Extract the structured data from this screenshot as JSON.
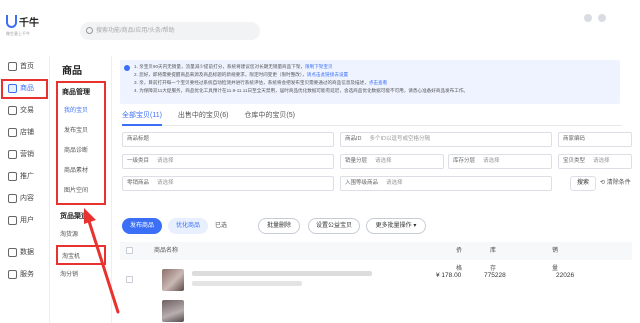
{
  "app": {
    "logo_text": "千牛",
    "logo_sub": "做生意上千牛",
    "search_placeholder": "搜索功能/商品/应用/头条/帮助"
  },
  "sidebar": {
    "items": [
      {
        "label": "首页",
        "icon": "home-icon"
      },
      {
        "label": "商品",
        "icon": "product-icon",
        "active": true
      },
      {
        "label": "交易",
        "icon": "trade-icon"
      },
      {
        "label": "店铺",
        "icon": "store-icon"
      },
      {
        "label": "营销",
        "icon": "marketing-icon"
      },
      {
        "label": "推广",
        "icon": "promotion-icon"
      },
      {
        "label": "内容",
        "icon": "content-icon"
      },
      {
        "label": "用户",
        "icon": "user-icon"
      },
      {
        "label": "数据",
        "icon": "data-icon"
      },
      {
        "label": "服务",
        "icon": "service-icon"
      }
    ]
  },
  "submenu": {
    "title": "商品",
    "group1": {
      "head": "商品管理",
      "items": [
        "我的宝贝",
        "发布宝贝",
        "商品诊断",
        "商品素材",
        "图片空间"
      ]
    },
    "group2": {
      "head": "货品渠道",
      "items": [
        "淘货源",
        "淘宝机",
        "淘分销"
      ]
    }
  },
  "notice": {
    "lines": [
      {
        "text": "1. 亲宝贝90天内无销量，流量减少提前打分，系统将建议您对长期无销量商品下架，",
        "link": "限制下架宝贝"
      },
      {
        "text": "2. 您好，即将需要提醒商品来源及商品标题的新规要求，限定时间变更（限时整改），",
        "link": "请点击此链接去设置"
      },
      {
        "text": "3. 亲，目前打开每一个宝贝要经过系统自动检测并进行系统评估，系统将会把发布宝贝需要通过的商品信息及描述，",
        "link": "点击查看"
      },
      {
        "text": "4. 为保障双11大促服务，商品优化工具预计在11.9-11.11日至全天禁用，届时商品优化数据可能有延迟，含选商品优化数据可能不可用，请悉心准备好商品发布工作。",
        "link": ""
      }
    ]
  },
  "tabs": [
    "全部宝贝(11)",
    "出售中的宝贝(6)",
    "仓库中的宝贝(5)"
  ],
  "filters": {
    "title_label": "商品标题",
    "id_label": "商品ID",
    "id_placeholder": "多个ID以逗号或空格分隔",
    "code_label": "商家编码",
    "category_label": "一级类目",
    "select_placeholder": "请选择",
    "sales_label": "销量分层",
    "stock_label": "库存分层",
    "type_label": "宝贝类型",
    "unlist_label": "零销商品",
    "source_label": "入围等级商品",
    "search_btn": "搜索",
    "clear_link": "清除条件"
  },
  "actions": {
    "publish": "发布商品",
    "optimize": "优化商品",
    "selected": "已选",
    "batch_delete": "批量删除",
    "set_public": "设置公益宝贝",
    "more": "更多批量操作"
  },
  "table": {
    "headers": {
      "name": "商品名称",
      "price": "价格",
      "stock": "库存",
      "sales": "销量"
    },
    "rows": [
      {
        "price": "¥ 178.00",
        "stock": "775228",
        "sales": "22026"
      }
    ]
  },
  "colors": {
    "accent": "#3b6ff5",
    "highlight": "#e8322f"
  }
}
